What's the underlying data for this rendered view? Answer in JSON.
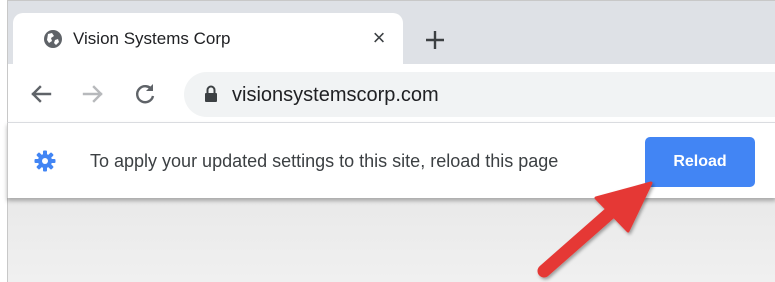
{
  "tab": {
    "title": "Vision Systems Corp",
    "close_glyph": "×",
    "favicon_icon": "globe-icon"
  },
  "toolbar": {
    "back_icon": "arrow-left-icon",
    "forward_icon": "arrow-right-icon",
    "reload_icon": "reload-icon",
    "new_tab_icon": "plus-icon",
    "url": "visionsystemscorp.com",
    "lock_icon": "lock-icon"
  },
  "infobar": {
    "icon": "gear-icon",
    "message": "To apply your updated settings to this site, reload this page",
    "button_label": "Reload"
  },
  "colors": {
    "accent": "#4285f4",
    "annotation_arrow": "#e53935",
    "tabstrip": "#dee1e6",
    "omnibox": "#f1f3f4"
  },
  "annotation": {
    "type": "arrow",
    "points_to": "reload-button"
  }
}
